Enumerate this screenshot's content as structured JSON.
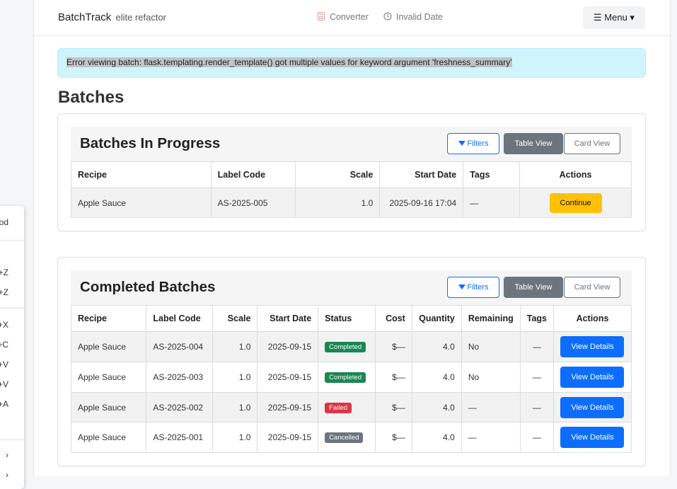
{
  "context_menu": {
    "items": [
      "od",
      "+Z",
      "+Z",
      "+X",
      "+C",
      "+V",
      "+V",
      "+A",
      "›",
      "›"
    ]
  },
  "navbar": {
    "brand": "BatchTrack",
    "brand_sub": "elite refactor",
    "links": [
      {
        "label": "Converter",
        "icon": "calculator-icon"
      },
      {
        "label": "Invalid Date",
        "icon": "clock-icon"
      }
    ],
    "menu_label": "☰ Menu ▾"
  },
  "alert": {
    "text": "Error viewing batch: flask.templating.render_template() got multiple values for keyword argument 'freshness_summary'"
  },
  "page_title": "Batches",
  "in_progress": {
    "title": "Batches In Progress",
    "filters_label": "Filters",
    "table_view_label": "Table View",
    "card_view_label": "Card View",
    "columns": [
      "Recipe",
      "Label Code",
      "Scale",
      "Start Date",
      "Tags",
      "Actions"
    ],
    "rows": [
      {
        "recipe": "Apple Sauce",
        "label_code": "AS-2025-005",
        "scale": "1.0",
        "start_date": "2025-09-16 17:04",
        "tags": "—",
        "action": "Continue"
      }
    ]
  },
  "completed": {
    "title": "Completed Batches",
    "filters_label": "Filters",
    "table_view_label": "Table View",
    "card_view_label": "Card View",
    "columns": [
      "Recipe",
      "Label Code",
      "Scale",
      "Start Date",
      "Status",
      "Cost",
      "Quantity",
      "Remaining",
      "Tags",
      "Actions"
    ],
    "rows": [
      {
        "recipe": "Apple Sauce",
        "label_code": "AS-2025-004",
        "scale": "1.0",
        "start_date": "2025-09-15",
        "status": "Completed",
        "status_color": "#198754",
        "cost": "$—",
        "quantity": "4.0",
        "remaining": "No",
        "tags": "—",
        "action": "View Details"
      },
      {
        "recipe": "Apple Sauce",
        "label_code": "AS-2025-003",
        "scale": "1.0",
        "start_date": "2025-09-15",
        "status": "Completed",
        "status_color": "#198754",
        "cost": "$—",
        "quantity": "4.0",
        "remaining": "No",
        "tags": "—",
        "action": "View Details"
      },
      {
        "recipe": "Apple Sauce",
        "label_code": "AS-2025-002",
        "scale": "1.0",
        "start_date": "2025-09-15",
        "status": "Failed",
        "status_color": "#dc3545",
        "cost": "$—",
        "quantity": "4.0",
        "remaining": "—",
        "tags": "—",
        "action": "View Details"
      },
      {
        "recipe": "Apple Sauce",
        "label_code": "AS-2025-001",
        "scale": "1.0",
        "start_date": "2025-09-15",
        "status": "Cancelled",
        "status_color": "#6c757d",
        "cost": "$—",
        "quantity": "4.0",
        "remaining": "—",
        "tags": "—",
        "action": "View Details"
      }
    ]
  },
  "colors": {
    "primary": "#0d6efd",
    "warning": "#ffc107",
    "secondary": "#6c757d",
    "alert_bg": "#cff4fc"
  }
}
